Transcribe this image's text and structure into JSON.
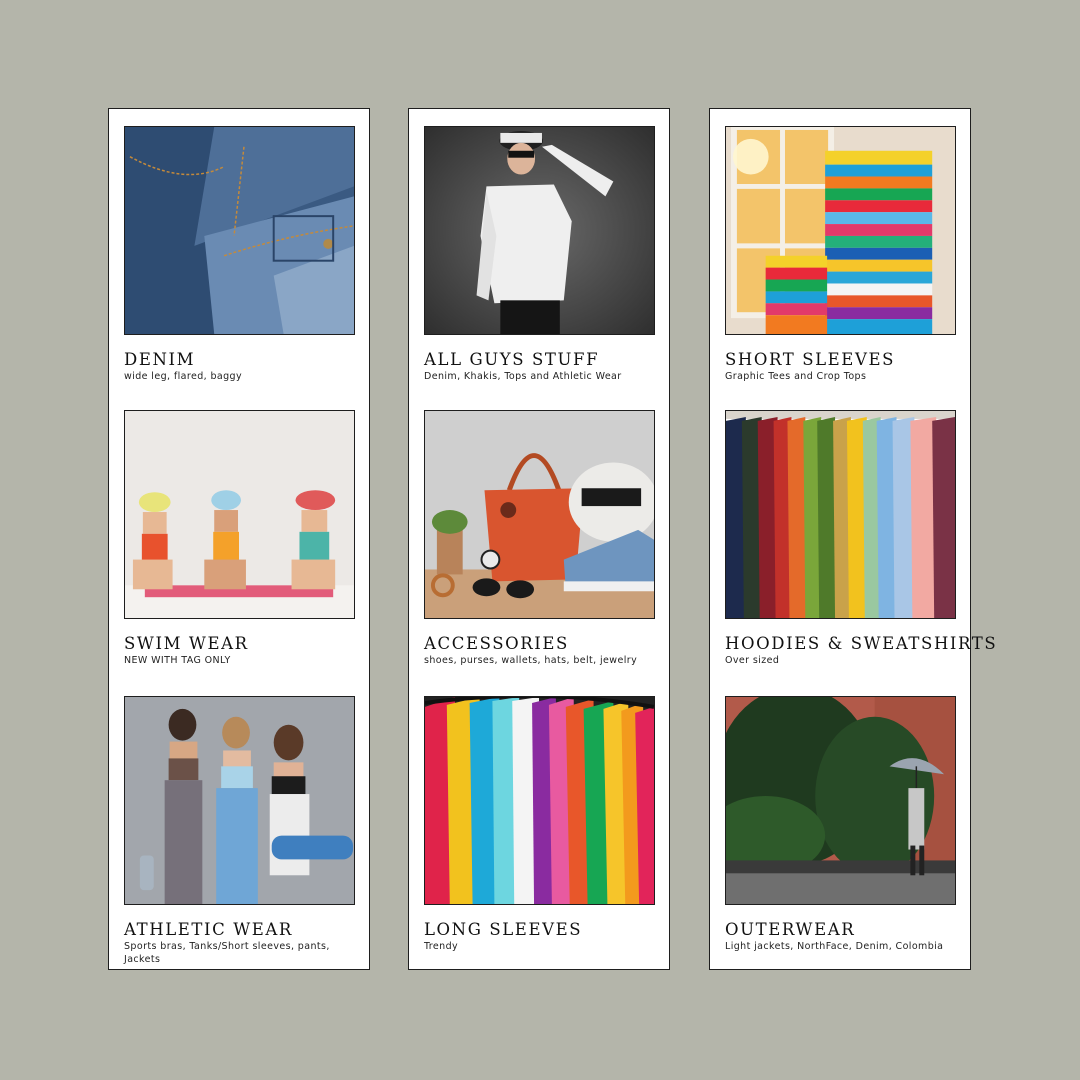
{
  "colors": {
    "background": "#b4b5aa",
    "card": "#ffffff",
    "border": "#1e1e1e"
  },
  "columns": [
    {
      "cards": [
        {
          "title": "DENIM",
          "subtitle": "wide leg, flared, baggy",
          "image": "denim-jeans-photo"
        },
        {
          "title": "SWIM WEAR",
          "subtitle": "NEW WITH TAG ONLY",
          "image": "swimwear-models-photo"
        },
        {
          "title": "ATHLETIC WEAR",
          "subtitle": "Sports bras, Tanks/Short sleeves, pants, Jackets",
          "image": "athletic-wear-models-photo"
        }
      ]
    },
    {
      "cards": [
        {
          "title": "ALL GUYS STUFF",
          "subtitle": "Denim, Khakis, Tops and Athletic Wear",
          "image": "man-in-cap-photo"
        },
        {
          "title": "ACCESSORIES",
          "subtitle": "shoes, purses, wallets, hats, belt,  jewelry",
          "image": "accessories-still-life-photo"
        },
        {
          "title": "LONG SLEEVES",
          "subtitle": "Trendy",
          "image": "colorful-shirts-on-rack-photo"
        }
      ]
    },
    {
      "cards": [
        {
          "title": "SHORT SLEEVES",
          "subtitle": "Graphic Tees and Crop Tops",
          "image": "stacked-tshirts-photo"
        },
        {
          "title": "HOODIES & SWEATSHIRTS",
          "subtitle": "Over sized",
          "image": "hoodies-on-rack-photo"
        },
        {
          "title": "OUTERWEAR",
          "subtitle": "Light jackets, NorthFace, Denim, Colombia",
          "image": "woman-with-umbrella-photo"
        }
      ]
    }
  ]
}
